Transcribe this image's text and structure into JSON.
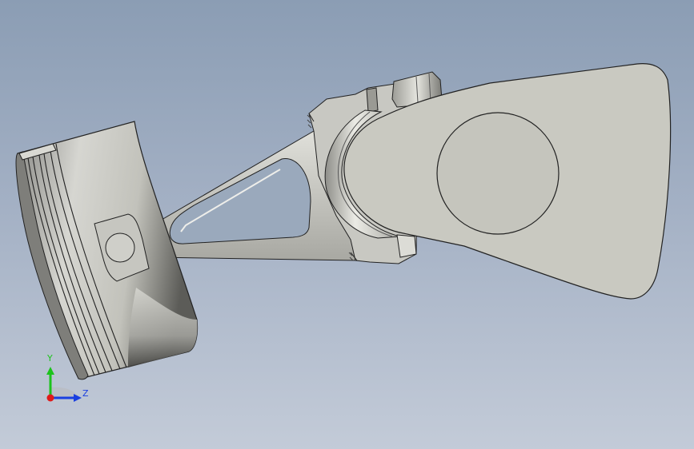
{
  "viewport": {
    "background_top": "#8b9db4",
    "background_bottom": "#c3cbd8"
  },
  "model": {
    "parts": [
      "piston",
      "piston-pin",
      "connecting-rod",
      "big-end-bearing",
      "rod-bolt",
      "crankshaft-web",
      "crankpin"
    ],
    "shade_color": "#c9c9c1",
    "edge_color": "#222222"
  },
  "triad": {
    "y_label": "Y",
    "z_label": "Z",
    "y_color": "#1cc31c",
    "z_color": "#1a3fe0",
    "x_color": "#e01a1a"
  }
}
